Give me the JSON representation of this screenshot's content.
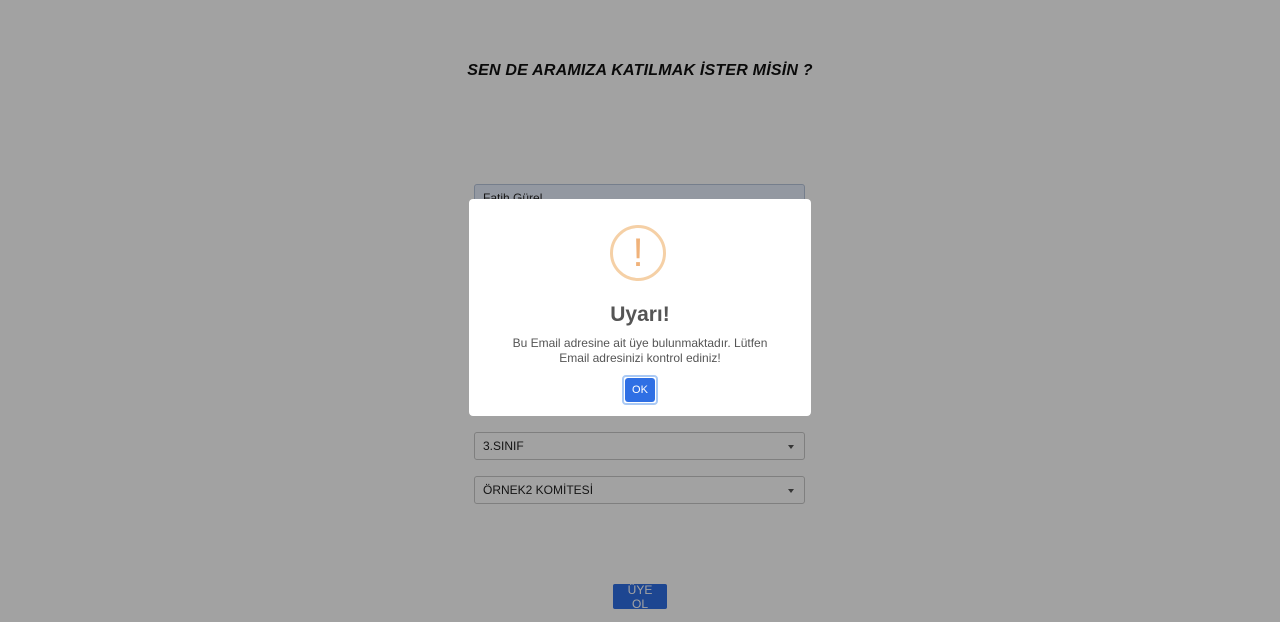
{
  "page": {
    "title": "SEN DE ARAMIZA KATILMAK İSTER MİSİN ?",
    "name_field_value": "Fatih Gürel",
    "class_select_value": "3.SINIF",
    "committee_select_value": "ÖRNEK2 KOMİTESİ",
    "submit_label": "ÜYE OL"
  },
  "modal": {
    "icon": "warning-exclamation-icon",
    "icon_glyph": "!",
    "title": "Uyarı!",
    "message": "Bu Email adresine ait üye bulunmaktadır. Lütfen Email adresinizi kontrol ediniz!",
    "ok_label": "OK"
  },
  "colors": {
    "primary_button": "#2f6fe4",
    "warning_icon": "#f0b27a",
    "overlay": "rgba(0,0,0,0.365)"
  }
}
